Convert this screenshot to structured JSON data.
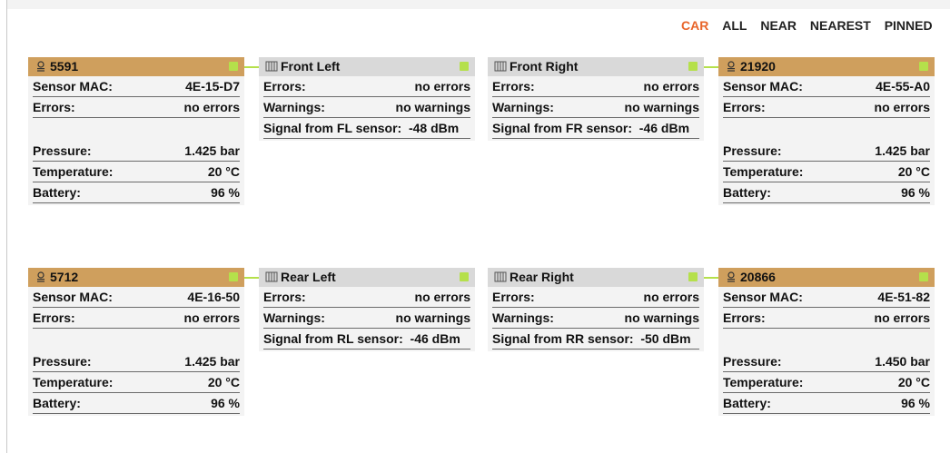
{
  "filters": [
    "CAR",
    "ALL",
    "NEAR",
    "NEAREST",
    "PINNED"
  ],
  "accent": "#e8652a",
  "sensor_color": "#cf9f5d",
  "status_dot_color": "#b5e04b",
  "labels": {
    "mac": "Sensor MAC:",
    "errors": "Errors:",
    "warnings": "Warnings:",
    "pressure": "Pressure:",
    "temperature": "Temperature:",
    "battery": "Battery:"
  },
  "sensors": {
    "fl": {
      "id": "5591",
      "mac": "4E-15-D7",
      "errors": "no errors",
      "pressure": "1.425 bar",
      "temperature": "20 °C",
      "battery": "96 %"
    },
    "fr": {
      "id": "21920",
      "mac": "4E-55-A0",
      "errors": "no errors",
      "pressure": "1.425 bar",
      "temperature": "20 °C",
      "battery": "96 %"
    },
    "rl": {
      "id": "5712",
      "mac": "4E-16-50",
      "errors": "no errors",
      "pressure": "1.425 bar",
      "temperature": "20 °C",
      "battery": "96 %"
    },
    "rr": {
      "id": "20866",
      "mac": "4E-51-82",
      "errors": "no errors",
      "pressure": "1.450 bar",
      "temperature": "20 °C",
      "battery": "96 %"
    }
  },
  "wheels": {
    "fl": {
      "title": "Front Left",
      "errors": "no errors",
      "warnings": "no warnings",
      "signal": "Signal from FL sensor:  -48 dBm"
    },
    "fr": {
      "title": "Front Right",
      "errors": "no errors",
      "warnings": "no warnings",
      "signal": "Signal from FR sensor:  -46 dBm"
    },
    "rl": {
      "title": "Rear Left",
      "errors": "no errors",
      "warnings": "no warnings",
      "signal": "Signal from RL sensor:  -46 dBm"
    },
    "rr": {
      "title": "Rear Right",
      "errors": "no errors",
      "warnings": "no warnings",
      "signal": "Signal from RR sensor:  -50 dBm"
    }
  }
}
